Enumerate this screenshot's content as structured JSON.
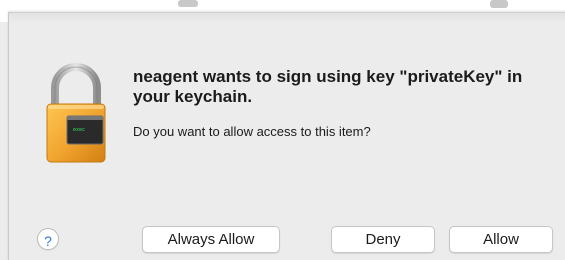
{
  "dialog": {
    "title": "neagent wants to sign using key \"privateKey\" in your keychain.",
    "message": "Do you want to allow access to this item?",
    "lock_icon": "padlock-terminal-icon",
    "lock_screen_text": "exec"
  },
  "buttons": {
    "help_label": "?",
    "always_allow_label": "Always Allow",
    "deny_label": "Deny",
    "allow_label": "Allow"
  },
  "colors": {
    "dialog_background": "#ececec",
    "lock_gold": "#f0a32e",
    "help_blue": "#2b78e4"
  }
}
